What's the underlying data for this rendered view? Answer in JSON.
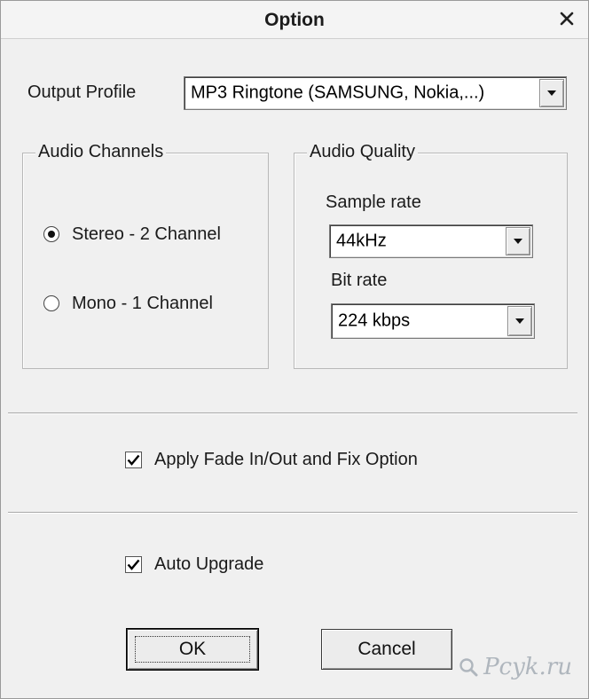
{
  "window": {
    "title": "Option",
    "close_icon": "close-icon"
  },
  "output_profile": {
    "label": "Output Profile",
    "selected": "MP3 Ringtone (SAMSUNG, Nokia,...)"
  },
  "audio_channels": {
    "legend": "Audio Channels",
    "options": [
      {
        "label": "Stereo - 2 Channel",
        "selected": true
      },
      {
        "label": "Mono - 1 Channel",
        "selected": false
      }
    ]
  },
  "audio_quality": {
    "legend": "Audio Quality",
    "sample_rate": {
      "label": "Sample rate",
      "selected": "44kHz"
    },
    "bit_rate": {
      "label": "Bit rate",
      "selected": "224 kbps"
    }
  },
  "options": {
    "fade": {
      "label": "Apply Fade In/Out and Fix Option",
      "checked": true
    },
    "auto_upgrade": {
      "label": "Auto Upgrade",
      "checked": true
    }
  },
  "buttons": {
    "ok": "OK",
    "cancel": "Cancel"
  },
  "watermark": {
    "text": "Pcyk.ru"
  }
}
